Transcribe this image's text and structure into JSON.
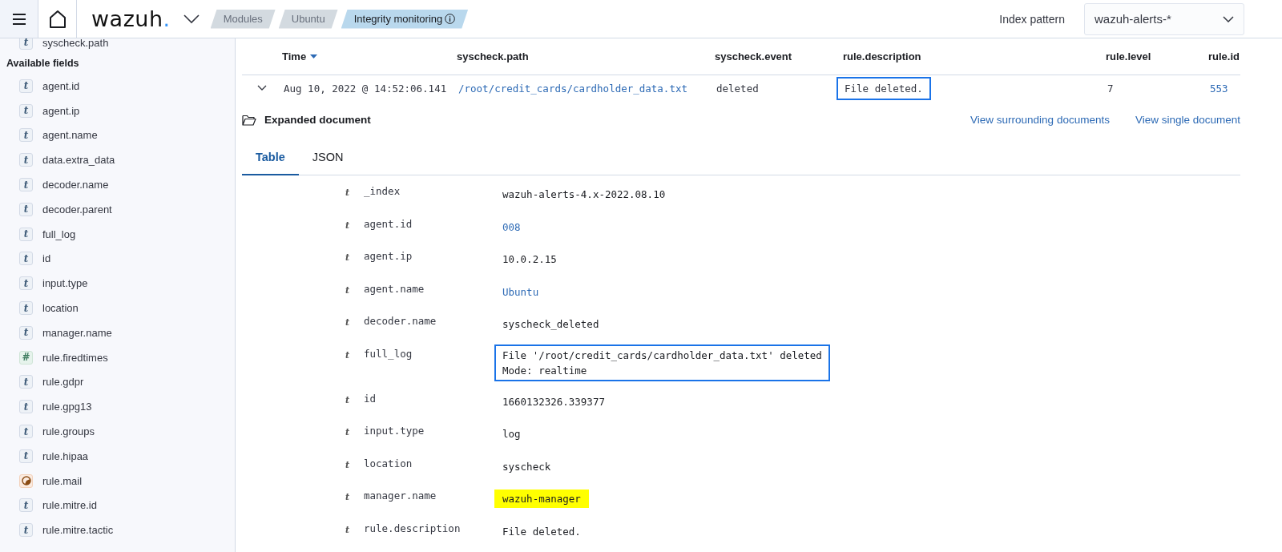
{
  "header": {
    "logo": "wazuh.",
    "breadcrumbs": [
      {
        "label": "Modules",
        "selected": false,
        "info": false
      },
      {
        "label": "Ubuntu",
        "selected": false,
        "info": false
      },
      {
        "label": "Integrity monitoring",
        "selected": true,
        "info": true
      }
    ],
    "index_pattern": {
      "label": "Index pattern",
      "value": "wazuh-alerts-*"
    }
  },
  "sidebar": {
    "selected_fields": [
      {
        "name": "syscheck.path",
        "kind": "string",
        "glyph": "t"
      }
    ],
    "available_heading": "Available fields",
    "available_fields": [
      {
        "name": "agent.id",
        "kind": "string",
        "glyph": "t"
      },
      {
        "name": "agent.ip",
        "kind": "string",
        "glyph": "t"
      },
      {
        "name": "agent.name",
        "kind": "string",
        "glyph": "t"
      },
      {
        "name": "data.extra_data",
        "kind": "string",
        "glyph": "t"
      },
      {
        "name": "decoder.name",
        "kind": "string",
        "glyph": "t"
      },
      {
        "name": "decoder.parent",
        "kind": "string",
        "glyph": "t"
      },
      {
        "name": "full_log",
        "kind": "string",
        "glyph": "t"
      },
      {
        "name": "id",
        "kind": "string",
        "glyph": "t"
      },
      {
        "name": "input.type",
        "kind": "string",
        "glyph": "t"
      },
      {
        "name": "location",
        "kind": "string",
        "glyph": "t"
      },
      {
        "name": "manager.name",
        "kind": "string",
        "glyph": "t"
      },
      {
        "name": "rule.firedtimes",
        "kind": "number",
        "glyph": "#"
      },
      {
        "name": "rule.gdpr",
        "kind": "string",
        "glyph": "t"
      },
      {
        "name": "rule.gpg13",
        "kind": "string",
        "glyph": "t"
      },
      {
        "name": "rule.groups",
        "kind": "string",
        "glyph": "t"
      },
      {
        "name": "rule.hipaa",
        "kind": "string",
        "glyph": "t"
      },
      {
        "name": "rule.mail",
        "kind": "unknown"
      },
      {
        "name": "rule.mitre.id",
        "kind": "string",
        "glyph": "t"
      },
      {
        "name": "rule.mitre.tactic",
        "kind": "string",
        "glyph": "t"
      }
    ]
  },
  "table": {
    "columns": [
      {
        "label": "Time",
        "sorted": true
      },
      {
        "label": "syscheck.path",
        "sorted": false
      },
      {
        "label": "syscheck.event",
        "sorted": false
      },
      {
        "label": "rule.description",
        "sorted": false
      },
      {
        "label": "rule.level",
        "sorted": false
      },
      {
        "label": "rule.id",
        "sorted": false
      }
    ],
    "rows": [
      {
        "expanded": true,
        "cells": [
          {
            "text": "Aug 10, 2022 @ 14:52:06.141",
            "kind": "text",
            "outlined": false
          },
          {
            "text": "/root/credit_cards/cardholder_data.txt",
            "kind": "link",
            "outlined": false
          },
          {
            "text": "deleted",
            "kind": "text",
            "outlined": false
          },
          {
            "text": "File deleted.",
            "kind": "text",
            "outlined": true
          },
          {
            "text": "7",
            "kind": "text",
            "outlined": false
          },
          {
            "text": "553",
            "kind": "link",
            "outlined": false
          }
        ]
      }
    ]
  },
  "document": {
    "title": "Expanded document",
    "links": [
      "View surrounding documents",
      "View single document"
    ],
    "tabs": [
      {
        "label": "Table",
        "selected": true
      },
      {
        "label": "JSON",
        "selected": false
      }
    ],
    "fields": [
      {
        "glyph": "t",
        "name": "_index",
        "value": "wazuh-alerts-4.x-2022.08.10",
        "kind": "text",
        "outlined": false,
        "highlighted": false
      },
      {
        "glyph": "t",
        "name": "agent.id",
        "value": "008",
        "kind": "link",
        "outlined": false,
        "highlighted": false
      },
      {
        "glyph": "t",
        "name": "agent.ip",
        "value": "10.0.2.15",
        "kind": "text",
        "outlined": false,
        "highlighted": false
      },
      {
        "glyph": "t",
        "name": "agent.name",
        "value": "Ubuntu",
        "kind": "link",
        "outlined": false,
        "highlighted": false
      },
      {
        "glyph": "t",
        "name": "decoder.name",
        "value": "syscheck_deleted",
        "kind": "text",
        "outlined": false,
        "highlighted": false
      },
      {
        "glyph": "t",
        "name": "full_log",
        "value": "File '/root/credit_cards/cardholder_data.txt' deleted\nMode: realtime",
        "kind": "text",
        "outlined": true,
        "highlighted": false
      },
      {
        "glyph": "t",
        "name": "id",
        "value": "1660132326.339377",
        "kind": "text",
        "outlined": false,
        "highlighted": false
      },
      {
        "glyph": "t",
        "name": "input.type",
        "value": "log",
        "kind": "text",
        "outlined": false,
        "highlighted": false
      },
      {
        "glyph": "t",
        "name": "location",
        "value": "syscheck",
        "kind": "text",
        "outlined": false,
        "highlighted": false
      },
      {
        "glyph": "t",
        "name": "manager.name",
        "value": "wazuh-manager",
        "kind": "text",
        "outlined": false,
        "highlighted": true
      },
      {
        "glyph": "t",
        "name": "rule.description",
        "value": "File deleted.",
        "kind": "text",
        "outlined": false,
        "highlighted": false
      }
    ]
  }
}
